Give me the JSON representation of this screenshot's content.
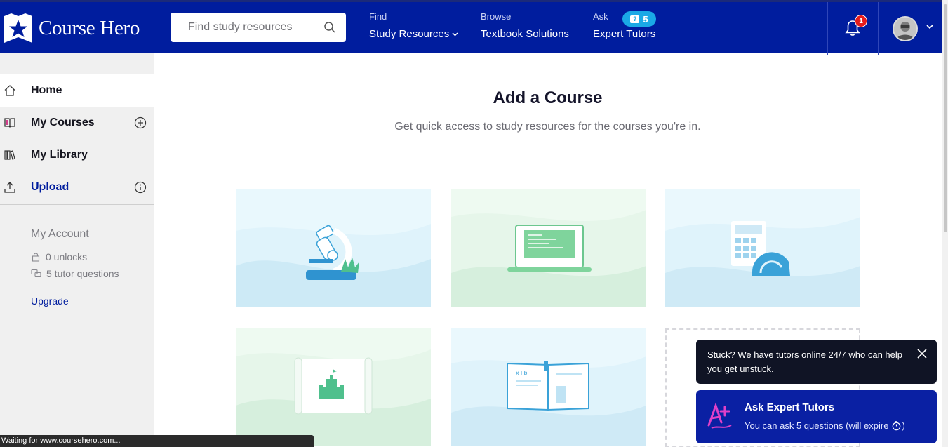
{
  "header": {
    "logo_text": "Course Hero",
    "search_placeholder": "Find study resources",
    "nav": [
      {
        "small": "Find",
        "label": "Study Resources"
      },
      {
        "small": "Browse",
        "label": "Textbook Solutions"
      },
      {
        "small": "Ask",
        "label": "Expert Tutors",
        "badge": "5"
      }
    ],
    "notification_count": "1",
    "brand_color": "#001d9e"
  },
  "sidebar": {
    "items": [
      {
        "label": "Home",
        "icon": "home-icon"
      },
      {
        "label": "My Courses",
        "icon": "book-icon"
      },
      {
        "label": "My Library",
        "icon": "library-icon"
      },
      {
        "label": "Upload",
        "icon": "upload-icon"
      }
    ],
    "account": {
      "title": "My Account",
      "unlocks": "0 unlocks",
      "tutor_questions": "5 tutor questions",
      "upgrade": "Upgrade"
    }
  },
  "main": {
    "title": "Add a Course",
    "subtitle": "Get quick access to study resources for the courses you're in.",
    "cards": [
      {
        "illustration": "microscope-illustration"
      },
      {
        "illustration": "laptop-code-illustration"
      },
      {
        "illustration": "calculator-protractor-illustration"
      },
      {
        "illustration": "castle-map-illustration"
      },
      {
        "illustration": "open-book-illustration"
      },
      {
        "illustration": "add-course-placeholder"
      }
    ]
  },
  "toasts": {
    "help": "Stuck? We have tutors online 24/7 who can help you get unstuck.",
    "cta_title": "Ask Expert Tutors",
    "cta_body": "You can ask 5 questions (will expire"
  },
  "status_bar": "Waiting for www.coursehero.com..."
}
